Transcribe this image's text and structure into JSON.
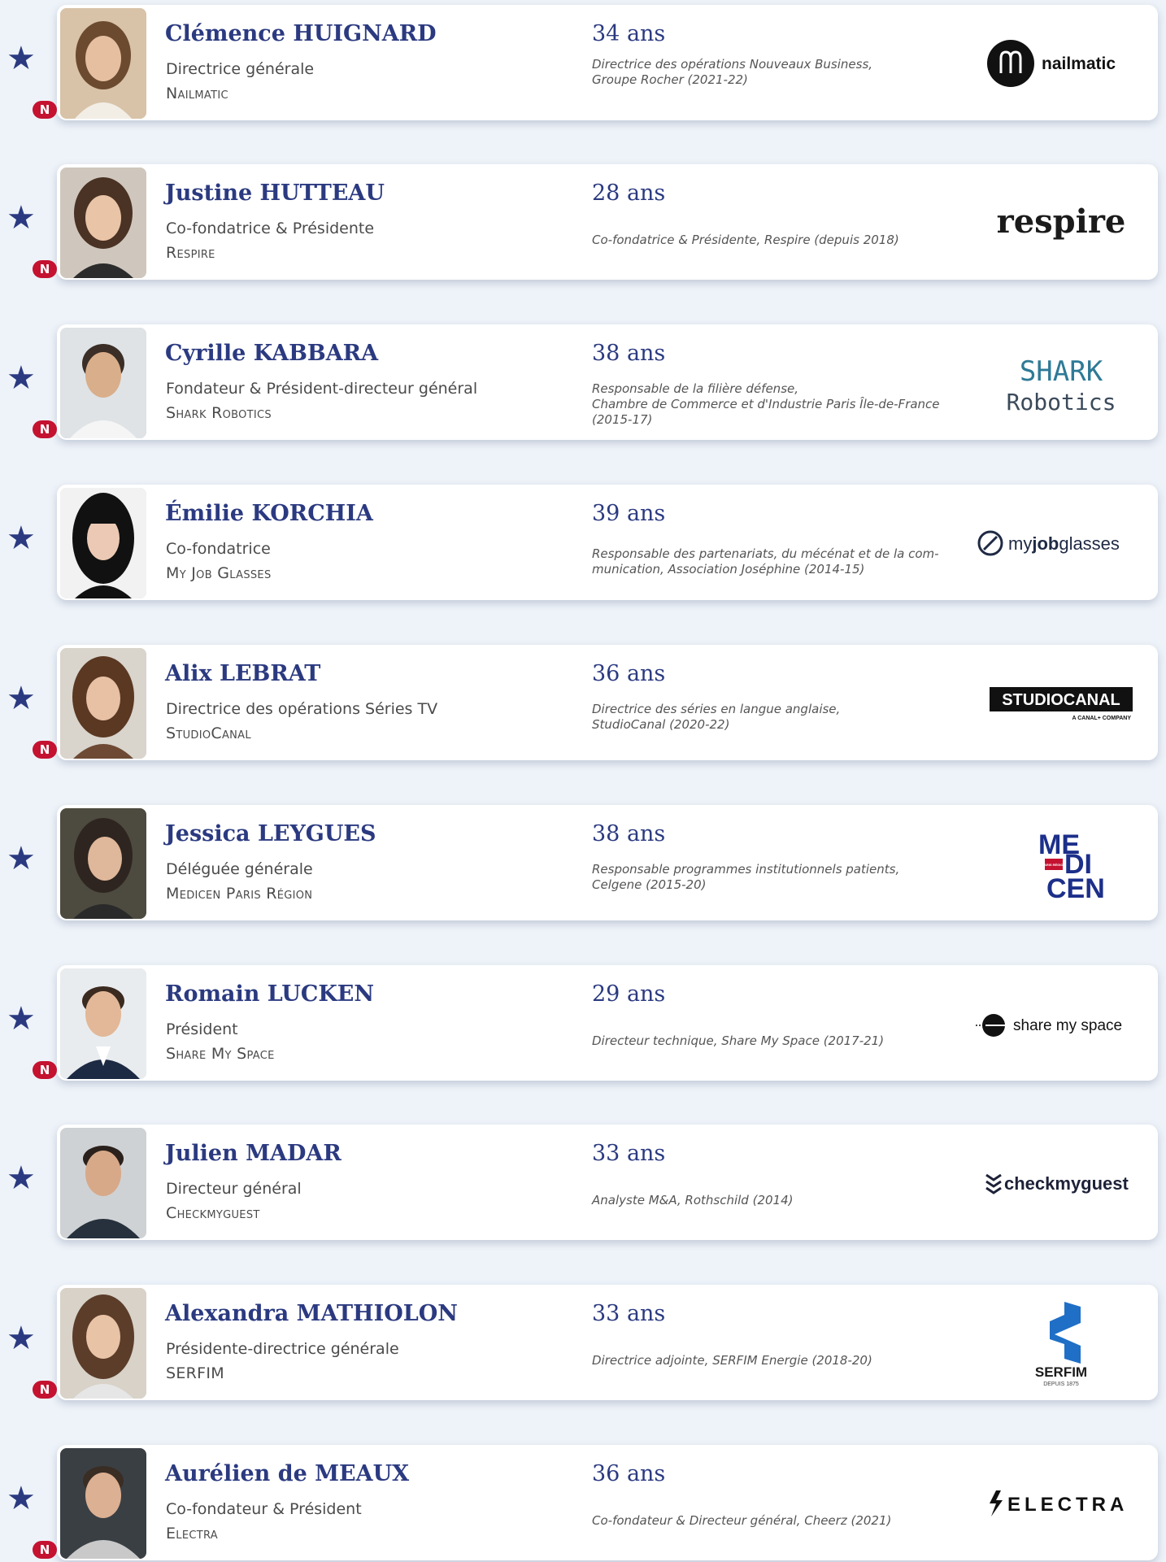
{
  "colors": {
    "accent": "#2b3a80",
    "badge": "#c41230",
    "background": "#eef3f9"
  },
  "badge_label": "N",
  "profiles": [
    {
      "name": "Clémence HUIGNARD",
      "role": "Directrice générale",
      "company": "Nailmatic",
      "age": "34 ans",
      "bio": "Directrice des opérations Nouveaux Business,\nGroupe Rocher (2021-22)",
      "logo_text": "nailmatic"
    },
    {
      "name": "Justine HUTTEAU",
      "role": "Co-fondatrice & Présidente",
      "company": "Respire",
      "age": "28 ans",
      "bio": "Co-fondatrice & Présidente, Respire (depuis 2018)",
      "logo_text": "respire"
    },
    {
      "name": "Cyrille KABBARA",
      "role": "Fondateur & Président-directeur général",
      "company": "Shark Robotics",
      "age": "38 ans",
      "bio": "Responsable de la filière défense,\nChambre de Commerce et d'Industrie Paris Île-de-France\n(2015-17)",
      "logo_line1": "SHARK",
      "logo_line2": "Robotics"
    },
    {
      "name": "Émilie KORCHIA",
      "role": "Co-fondatrice",
      "company": "My Job Glasses",
      "age": "39 ans",
      "bio": "Responsable des partenariats, du mécénat et de la com-\nmunication, Association Joséphine (2014-15)",
      "logo_a": "my",
      "logo_b": "job",
      "logo_c": "glasses"
    },
    {
      "name": "Alix LEBRAT",
      "role": "Directrice des opérations Séries TV",
      "company": "StudioCanal",
      "age": "36 ans",
      "bio": "Directrice des séries en langue anglaise,\nStudioCanal (2020-22)",
      "logo_text": "STUDIOCANAL",
      "logo_sub": "A CANAL+ COMPANY"
    },
    {
      "name": "Jessica LEYGUES",
      "role": "Déléguée générale",
      "company": "Medicen Paris Région",
      "age": "38 ans",
      "bio": "Responsable programmes institutionnels patients,\nCelgene (2015-20)",
      "logo_l1": "ME",
      "logo_l2": "DI",
      "logo_l3": "CEN",
      "logo_tag": "PARIS RÉGION"
    },
    {
      "name": "Romain LUCKEN",
      "role": "Président",
      "company": "Share My Space",
      "age": "29 ans",
      "bio": "Directeur technique, Share My Space (2017-21)",
      "logo_text": "share my space"
    },
    {
      "name": "Julien MADAR",
      "role": "Directeur général",
      "company": "Checkmyguest",
      "age": "33 ans",
      "bio": "Analyste M&A, Rothschild (2014)",
      "logo_text": "checkmyguest"
    },
    {
      "name": "Alexandra MATHIOLON",
      "role": "Présidente-directrice générale",
      "company": "SERFIM",
      "age": "33 ans",
      "bio": "Directrice adjointe, SERFIM Energie (2018-20)",
      "logo_text": "SERFIM",
      "logo_sub": "DEPUIS 1875"
    },
    {
      "name": "Aurélien de MEAUX",
      "role": "Co-fondateur & Président",
      "company": "Electra",
      "age": "36 ans",
      "bio": "Co-fondateur & Directeur général, Cheerz (2021)",
      "logo_text": "ELECTRA"
    }
  ]
}
